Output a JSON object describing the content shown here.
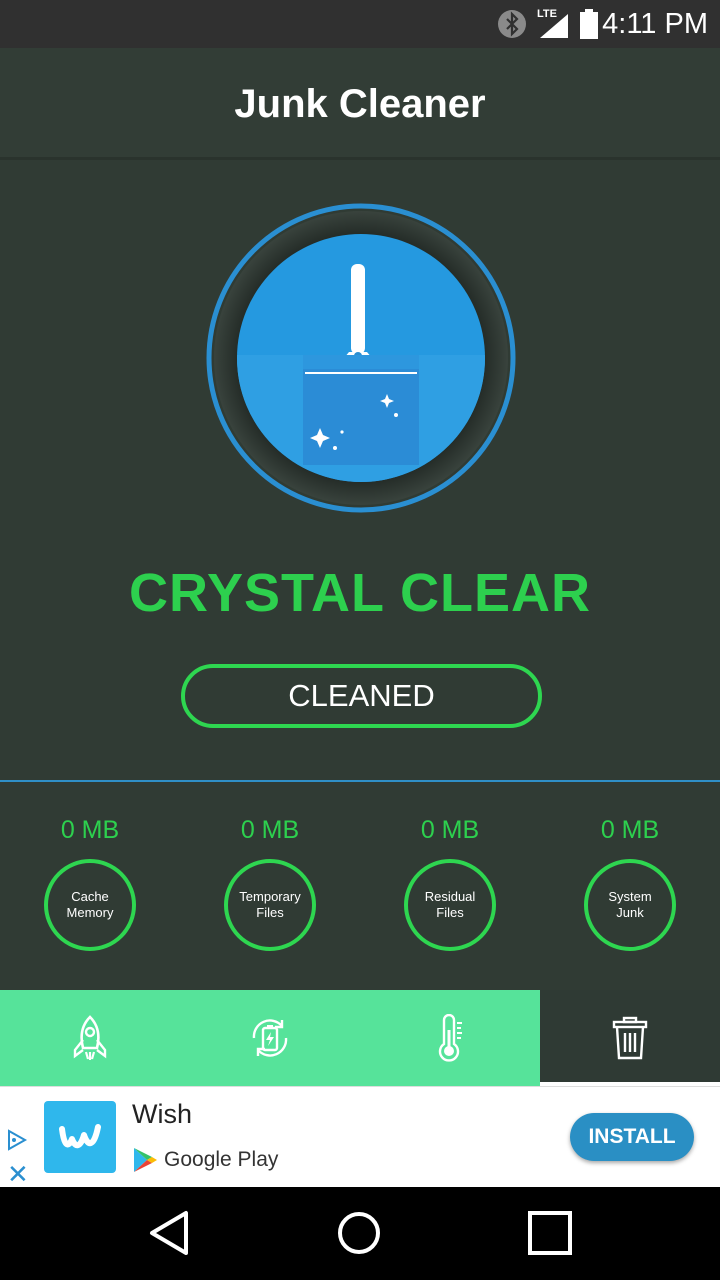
{
  "status_bar": {
    "time": "4:11 PM",
    "network": "LTE",
    "icons": [
      "bluetooth-icon",
      "signal-icon",
      "battery-icon"
    ]
  },
  "header": {
    "title": "Junk Cleaner"
  },
  "main": {
    "status_text": "CRYSTAL CLEAR",
    "button_label": "CLEANED",
    "graphic_icon": "broom-icon"
  },
  "stats": [
    {
      "amount": "0 MB",
      "line1": "Cache",
      "line2": "Memory"
    },
    {
      "amount": "0 MB",
      "line1": "Temporary",
      "line2": "Files"
    },
    {
      "amount": "0 MB",
      "line1": "Residual",
      "line2": "Files"
    },
    {
      "amount": "0 MB",
      "line1": "System",
      "line2": "Junk"
    }
  ],
  "bottom_nav": {
    "items": [
      {
        "icon": "rocket-icon",
        "active": false
      },
      {
        "icon": "battery-saver-icon",
        "active": false
      },
      {
        "icon": "thermometer-icon",
        "active": false
      },
      {
        "icon": "trash-icon",
        "active": true
      }
    ]
  },
  "ad": {
    "app_name": "Wish",
    "store_label": "Google Play",
    "install_label": "INSTALL"
  },
  "colors": {
    "accent_green": "#2dd04e",
    "nav_green": "#56e39a",
    "background": "#303b34",
    "blue": "#2f8fc7"
  }
}
